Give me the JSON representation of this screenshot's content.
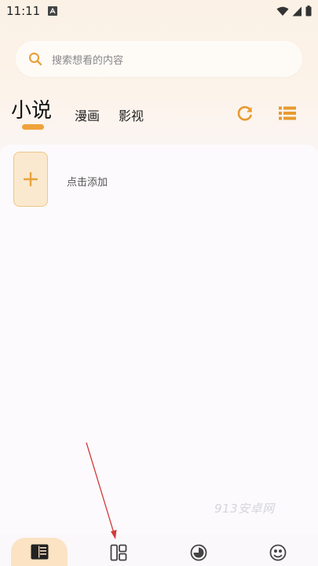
{
  "status_bar": {
    "time": "11:11"
  },
  "search": {
    "placeholder": "搜索想看的内容"
  },
  "tabs": [
    {
      "label": "小说",
      "selected": true
    },
    {
      "label": "漫画",
      "selected": false
    },
    {
      "label": "影视",
      "selected": false
    }
  ],
  "toolbar": {
    "refresh_icon": "refresh-icon",
    "list_icon": "list-icon"
  },
  "shelf": {
    "add_label": "点击添加"
  },
  "watermark": "913安卓网",
  "bottom_nav": [
    {
      "icon": "bookshelf-icon",
      "selected": true
    },
    {
      "icon": "discover-icon",
      "selected": false
    },
    {
      "icon": "rss-icon",
      "selected": false
    },
    {
      "icon": "mine-icon",
      "selected": false
    }
  ],
  "colors": {
    "accent": "#f0a23a",
    "card_fill": "#fbe9cf",
    "card_border": "#efc58a",
    "arrow": "#d23a3a"
  }
}
